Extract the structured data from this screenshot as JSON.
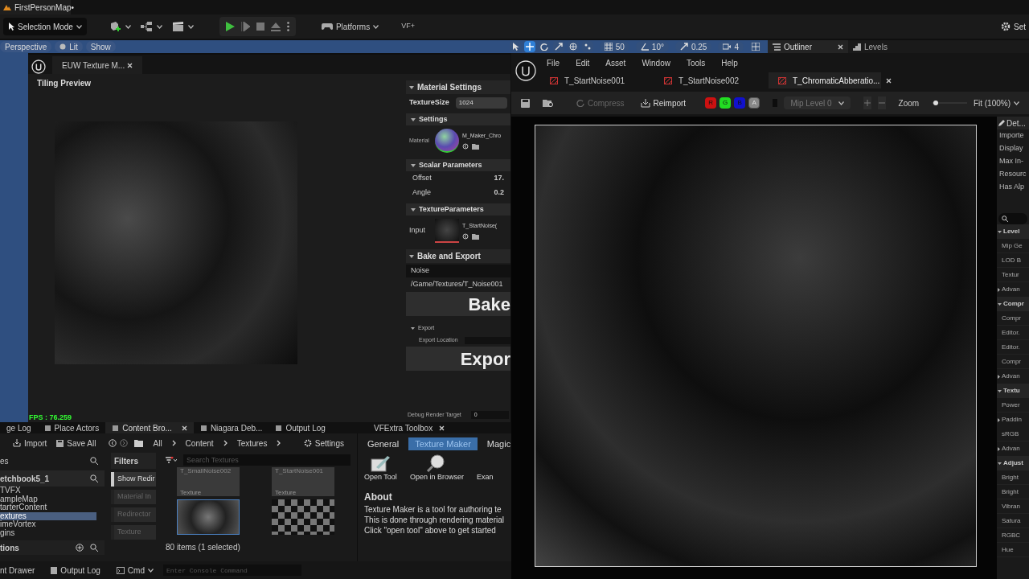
{
  "level_tab": {
    "label": "FirstPersonMap•"
  },
  "main_toolbar": {
    "mode": "Selection Mode",
    "platforms": "Platforms",
    "plugin": "VF+",
    "settings": "Set"
  },
  "viewport": {
    "buttons": [
      "Perspective",
      "Lit",
      "Show"
    ],
    "fps": "FPS : 76.259"
  },
  "snap_settings": [
    {
      "kind": "grid",
      "value": "50"
    },
    {
      "kind": "angle",
      "value": "10°"
    },
    {
      "kind": "scale",
      "value": "0.25"
    },
    {
      "kind": "camera",
      "value": "4"
    }
  ],
  "outliner_tabs": [
    {
      "label": "Outliner",
      "selected": true
    },
    {
      "label": "Levels",
      "selected": false
    }
  ],
  "widget_window": {
    "tab": "EUW Texture M...",
    "preview_label": "Tiling Preview",
    "panel": {
      "material_settings": "Material Settings",
      "texture_size_label": "TextureSize",
      "texture_size": "1024",
      "settings": "Settings",
      "material_label": "Material",
      "material_name": "M_Maker_Chro",
      "scalar_parameters": "Scalar Parameters",
      "scalars": [
        {
          "label": "Offset",
          "value": "17."
        },
        {
          "label": "Angle",
          "value": "0.2"
        }
      ],
      "texture_parameters": "TextureParameters",
      "input_label": "Input",
      "input_name": "T_StartNoise(",
      "bake_and_export": "Bake and Export",
      "name_value": "Noise",
      "path": "/Game/Textures/T_Noise001",
      "bake_button": "Bake",
      "export": "Export",
      "export_location": "Export Location",
      "export_button": "Expor",
      "debug_label": "Debug Render Target",
      "debug_value": "0"
    }
  },
  "texture_editor": {
    "menu": [
      "File",
      "Edit",
      "Asset",
      "Window",
      "Tools",
      "Help"
    ],
    "tabs": [
      {
        "label": "T_StartNoise001",
        "selected": false
      },
      {
        "label": "T_StartNoise002",
        "selected": false
      },
      {
        "label": "T_ChromaticAbberatio...",
        "selected": true
      }
    ],
    "compress": {
      "label": "Compress",
      "disabled": true
    },
    "reimport": "Reimport",
    "channels": [
      {
        "label": "R",
        "on": true,
        "color": "#cc1111"
      },
      {
        "label": "G",
        "on": true,
        "color": "#22dd22"
      },
      {
        "label": "B",
        "on": true,
        "color": "#1111cc"
      },
      {
        "label": "A",
        "on": false,
        "color": "#888888"
      }
    ],
    "mip": "Mip Level 0",
    "zoom_label": "Zoom",
    "zoom": {
      "level": 0.03
    },
    "fit": "Fit (100%)",
    "details": {
      "tab": "Det...",
      "properties": [
        "Importe",
        "Display",
        "Max In-",
        "Resourc",
        "Has Alp"
      ],
      "rows": [
        {
          "kind": "section",
          "label": "Level"
        },
        {
          "kind": "property",
          "label": "Mip Ge"
        },
        {
          "kind": "property",
          "label": "LOD B"
        },
        {
          "kind": "property",
          "label": "Textur"
        },
        {
          "kind": "group",
          "label": "Advan"
        },
        {
          "kind": "section",
          "label": "Compr"
        },
        {
          "kind": "property",
          "label": "Compr"
        },
        {
          "kind": "property",
          "label": "Editor."
        },
        {
          "kind": "property",
          "label": "Editor."
        },
        {
          "kind": "property",
          "label": "Compr"
        },
        {
          "kind": "group",
          "label": "Advan"
        },
        {
          "kind": "section",
          "label": "Textu"
        },
        {
          "kind": "property",
          "label": "Power"
        },
        {
          "kind": "group",
          "label": "Paddin"
        },
        {
          "kind": "property",
          "label": "sRGB"
        },
        {
          "kind": "group",
          "label": "Advan"
        },
        {
          "kind": "section",
          "label": "Adjust"
        },
        {
          "kind": "property",
          "label": "Bright"
        },
        {
          "kind": "property",
          "label": "Bright"
        },
        {
          "kind": "property",
          "label": "Vibran"
        },
        {
          "kind": "property",
          "label": "Satura"
        },
        {
          "kind": "property",
          "label": "RGBC"
        },
        {
          "kind": "property",
          "label": "Hue"
        }
      ]
    }
  },
  "bottom_tabs": [
    {
      "label": "ge Log",
      "selected": false
    },
    {
      "label": "Place Actors",
      "selected": false
    },
    {
      "label": "Content Bro...",
      "selected": true
    },
    {
      "label": "Niagara Deb...",
      "selected": false
    },
    {
      "label": "Output Log",
      "selected": false
    }
  ],
  "content_browser": {
    "import": "Import",
    "save_all": "Save All",
    "path": [
      "All",
      "Content",
      "Textures"
    ],
    "settings": "Settings",
    "sources_header": "es",
    "root": "etchbook5_1",
    "folders": [
      {
        "label": "TVFX",
        "selected": false
      },
      {
        "label": "ampleMap",
        "selected": false
      },
      {
        "label": "tarterContent",
        "selected": false
      },
      {
        "label": "extures",
        "selected": true
      },
      {
        "label": "imeVortex",
        "selected": false
      },
      {
        "label": "gins",
        "selected": false
      }
    ],
    "collections": "tions",
    "filters_title": "Filters",
    "filters": [
      {
        "label": "Show Redir",
        "checked": true
      },
      {
        "label": "Material In",
        "checked": false
      },
      {
        "label": "Redirector",
        "checked": false
      },
      {
        "label": "Texture",
        "checked": false
      }
    ],
    "search": {
      "placeholder": "Search Textures"
    },
    "assets": [
      {
        "name": "T_SmallNoise002",
        "type": "Texture",
        "kind": "card",
        "selected": false
      },
      {
        "name": "T_StartNoise001",
        "type": "Texture",
        "kind": "card",
        "selected": false
      },
      {
        "kind": "noise",
        "selected": true
      },
      {
        "kind": "checker",
        "selected": false
      }
    ],
    "count": "80 items (1 selected)"
  },
  "toolbox": {
    "tab": "VFExtra Toolbox",
    "tabs": [
      {
        "label": "General",
        "selected": false
      },
      {
        "label": "Texture Maker",
        "selected": true
      },
      {
        "label": "Magic",
        "selected": false
      }
    ],
    "tools": [
      {
        "label": "Open Tool",
        "kind": "edit"
      },
      {
        "label": "Open in Browser",
        "kind": "browse"
      },
      {
        "label": "Exan",
        "kind": "none"
      }
    ],
    "about_title": "About",
    "about_lines": [
      "Texture Maker is a tool for authoring te",
      "This is done through rendering material",
      "Click \"open tool\" above to get started"
    ]
  },
  "status_bar": {
    "drawer": "nt Drawer",
    "output_log": "Output Log",
    "cmd": "Cmd",
    "console": {
      "placeholder": "Enter Console Command"
    }
  }
}
